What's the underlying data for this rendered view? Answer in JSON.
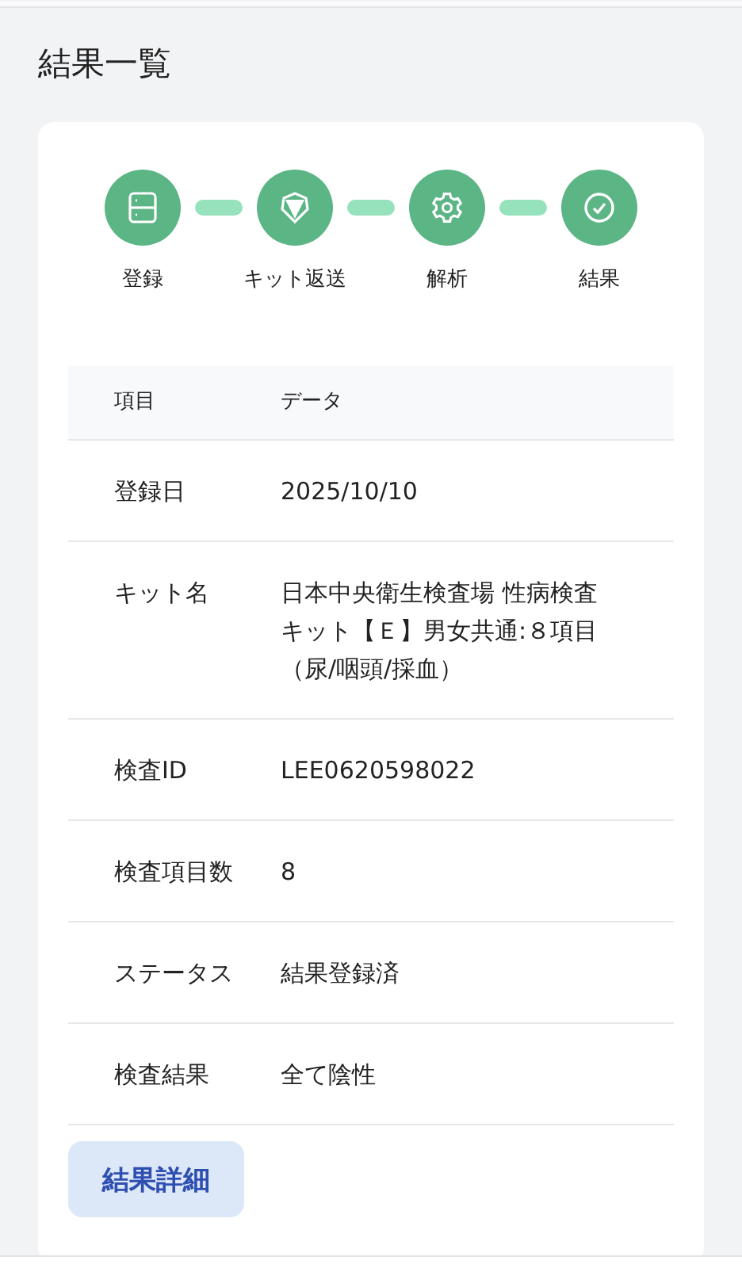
{
  "page_title": "結果一覧",
  "steps": [
    {
      "label": "登録"
    },
    {
      "label": "キット返送"
    },
    {
      "label": "解析"
    },
    {
      "label": "結果"
    }
  ],
  "table": {
    "columns": [
      "項目",
      "データ"
    ],
    "rows": [
      {
        "item": "登録日",
        "value": "2025/10/10"
      },
      {
        "item": "キット名",
        "value": "日本中央衛生検査場 性病検査キット【Ｅ】男女共通:８項目（尿/咽頭/採血）"
      },
      {
        "item": "検査ID",
        "value": "LEE0620598022"
      },
      {
        "item": "検査項目数",
        "value": "8"
      },
      {
        "item": "ステータス",
        "value": "結果登録済"
      },
      {
        "item": "検査結果",
        "value": "全て陰性"
      }
    ]
  },
  "detail_button": "結果詳細"
}
